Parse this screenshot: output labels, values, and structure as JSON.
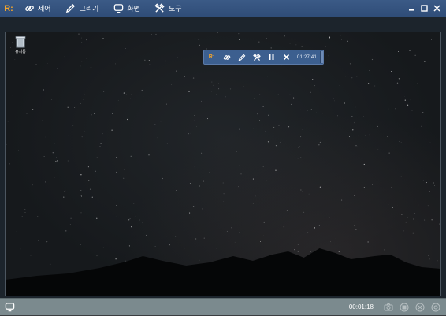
{
  "app": {
    "logo_text": "R:",
    "menu": [
      {
        "label": "제어",
        "icon": "link-icon"
      },
      {
        "label": "그리기",
        "icon": "pen-icon"
      },
      {
        "label": "화면",
        "icon": "monitor-icon"
      },
      {
        "label": "도구",
        "icon": "tools-icon"
      }
    ]
  },
  "desktop": {
    "recycle_bin_label": "휴지통"
  },
  "floating_toolbar": {
    "logo_text": "R:",
    "time": "01:27:41"
  },
  "status": {
    "elapsed": "00:01:18"
  },
  "colors": {
    "titlebar": "#2f4d78",
    "accent_orange": "#f4a52c",
    "statusbar": "#7b8a8e"
  }
}
